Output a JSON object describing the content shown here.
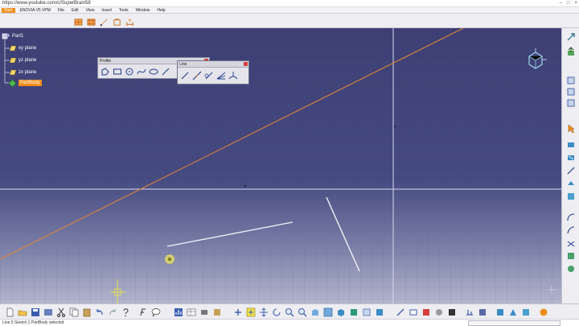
{
  "window": {
    "title": "https://www.youtube.com/c/SuperBrain58",
    "min_glyph": "–",
    "max_glyph": "□",
    "close_glyph": "×"
  },
  "menu": {
    "start": "Start",
    "items": [
      "ENOVIA V5 VPM",
      "File",
      "Edit",
      "View",
      "Insert",
      "Tools",
      "Window",
      "Help"
    ]
  },
  "tree": {
    "root": "Part1",
    "planes": [
      "xy plane",
      "yz plane",
      "zx plane"
    ],
    "body": "PartBody"
  },
  "toolbars": {
    "profile": {
      "title": "Profile",
      "icons": [
        "profile-icon",
        "rectangle-icon",
        "circle-icon",
        "spline-icon",
        "ellipse-icon",
        "line-icon"
      ]
    },
    "line": {
      "title": "Line",
      "icons": [
        "line-icon",
        "infinite-line-icon",
        "bi-tangent-line-icon",
        "bisecting-line-icon",
        "line-normal-to-curve-icon"
      ]
    }
  },
  "status": {
    "text": "Line.5 Sketch.1 PartBody selected",
    "command_input": ""
  },
  "colors": {
    "viewport_top": "#3d3f74",
    "viewport_bottom": "#b3b6cc",
    "construction_line": "#e0833c",
    "sketch_line": "#ffffff",
    "selection_orange": "#f28c1a"
  }
}
